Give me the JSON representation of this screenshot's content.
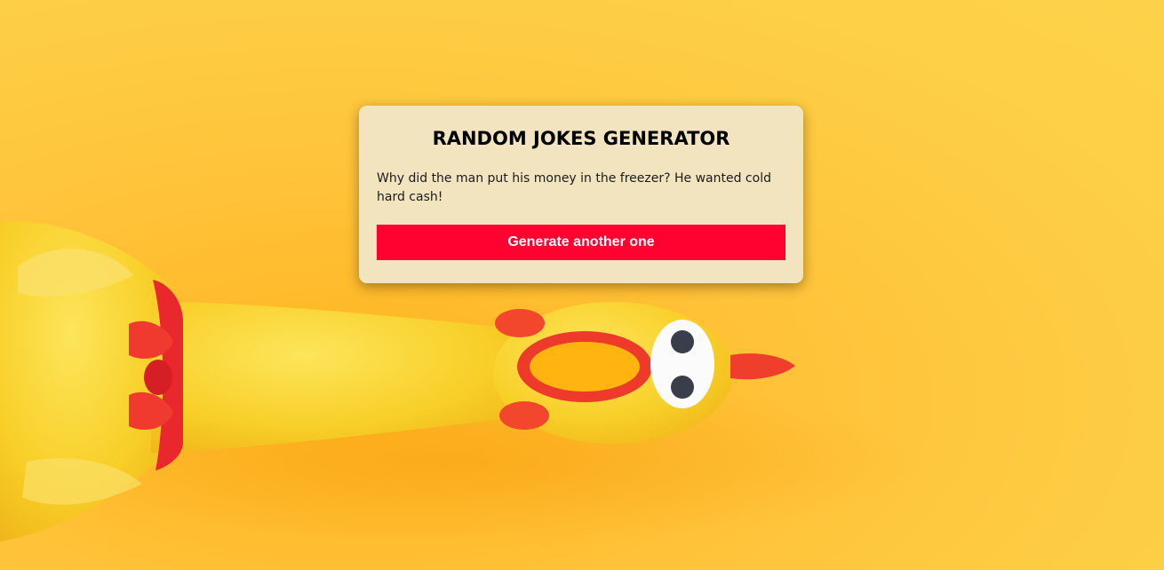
{
  "card": {
    "title": "RANDOM JOKES GENERATOR",
    "joke": "Why did the man put his money in the freezer? He wanted cold hard cash!",
    "button_label": "Generate another one"
  },
  "colors": {
    "background": "#fdcc45",
    "card_background": "#f2e4be",
    "button": "#ff0230",
    "button_text": "#ffffff",
    "chicken_body": "#f9d22a",
    "chicken_accent": "#f2332a"
  },
  "background_image": "rubber-chicken"
}
